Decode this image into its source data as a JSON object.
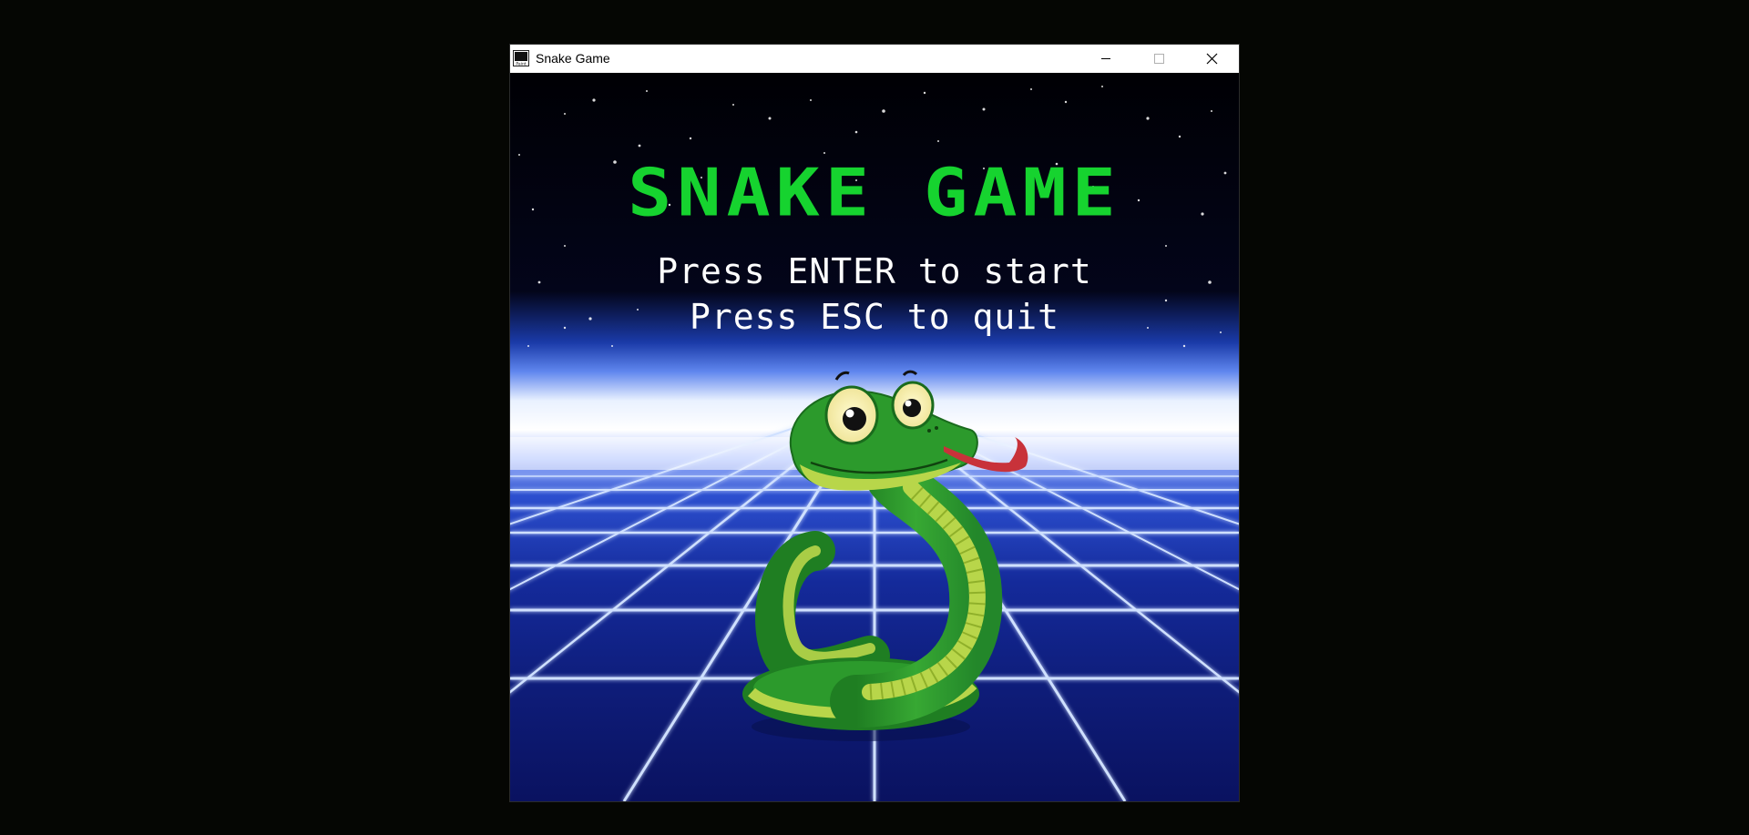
{
  "window": {
    "title": "Snake Game",
    "icon": "app-icon",
    "controls": {
      "minimize_icon": "minimize-icon",
      "maximize_icon": "maximize-icon",
      "close_icon": "close-icon"
    }
  },
  "game": {
    "title": "SNAKE GAME",
    "start_prompt": "Press ENTER to start",
    "quit_prompt": "Press ESC to quit",
    "mascot": "snake-mascot",
    "background": "neon-grid-starfield"
  },
  "colors": {
    "title": "#16d32f",
    "prompt": "#ffffff",
    "grid_glow": "#4a78ff",
    "horizon": "#ffffff",
    "sky": "#000006",
    "snake_body": "#2c9a2c",
    "snake_belly": "#b8d64a",
    "tongue": "#c8323a"
  }
}
